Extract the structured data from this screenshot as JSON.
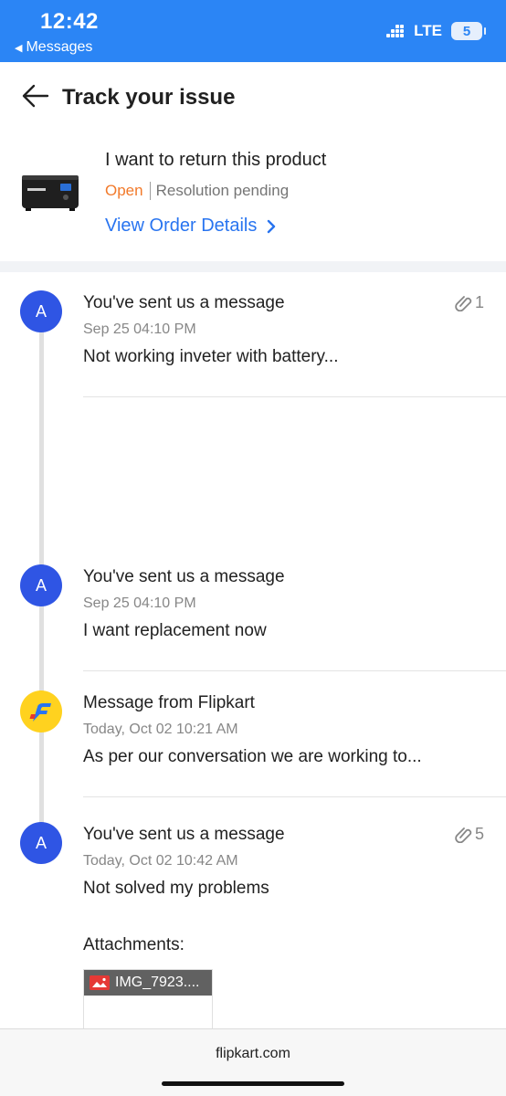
{
  "status_bar": {
    "time": "12:42",
    "back_app": "Messages",
    "network": "LTE",
    "battery": "5"
  },
  "header": {
    "title": "Track your issue"
  },
  "issue": {
    "title": "I want to return this product",
    "status": "Open",
    "resolution": "Resolution pending",
    "view_order_label": "View Order Details"
  },
  "messages": [
    {
      "avatar": "A",
      "title": "You've sent us a message",
      "time": "Sep 25 04:10 PM",
      "text": "Not working inveter with battery...",
      "attachments": "1"
    },
    {
      "avatar": "A",
      "title": "You've sent us a message",
      "time": "Sep 25 04:10 PM",
      "text": "I want replacement now"
    },
    {
      "avatar": "flipkart-logo",
      "title": "Message from Flipkart",
      "time": "Today, Oct 02 10:21 AM",
      "text": "As per our conversation we are working to..."
    },
    {
      "avatar": "A",
      "title": "You've sent us a message",
      "time": "Today, Oct 02 10:42 AM",
      "text": "Not solved my problems",
      "attachments": "5",
      "attachments_label": "Attachments:",
      "attachment_file": "IMG_7923...."
    }
  ],
  "browser": {
    "url": "flipkart.com"
  },
  "colors": {
    "status_bar": "#2b85f5",
    "link": "#2874f0",
    "open_status": "#f27a2b",
    "avatar": "#2f55e4",
    "flipkart_yellow": "#ffd21f"
  }
}
